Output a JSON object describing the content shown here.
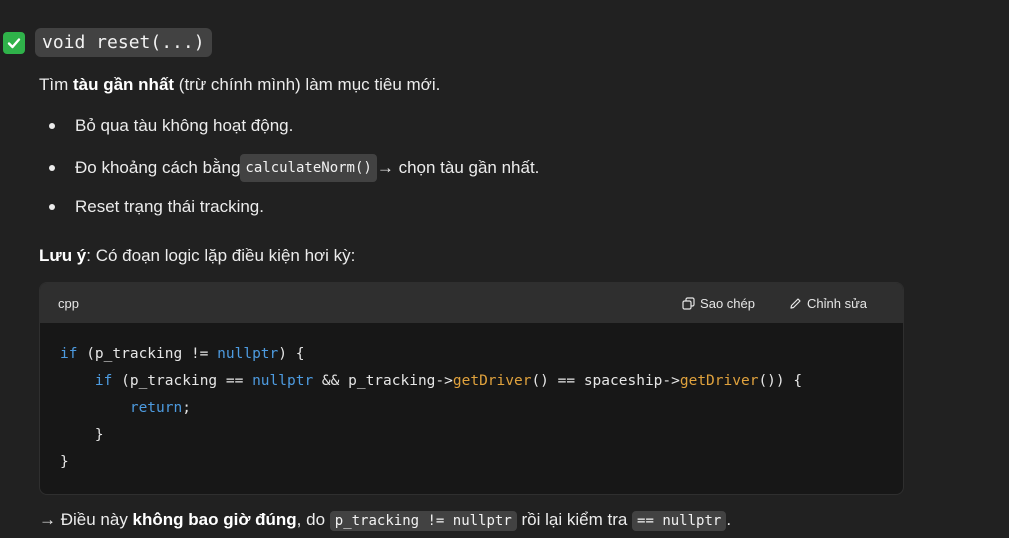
{
  "heading": {
    "code": "void reset(...)"
  },
  "intro": {
    "prefix": "Tìm ",
    "bold": "tàu gần nhất",
    "suffix": " (trừ chính mình) làm mục tiêu mới."
  },
  "bullets": {
    "item1": "Bỏ qua tàu không hoạt động.",
    "item2_prefix": "Đo khoảng cách bằng ",
    "item2_code": "calculateNorm()",
    "item2_suffix": " → chọn tàu gần nhất.",
    "item3": "Reset trạng thái tracking."
  },
  "note": {
    "bold": "Lưu ý",
    "text": ": Có đoạn logic lặp điều kiện hơi kỳ:"
  },
  "codeblock": {
    "language": "cpp",
    "copy_label": "Sao chép",
    "edit_label": "Chỉnh sửa",
    "line1_kw": "if",
    "line1_a": " (p_tracking != ",
    "line1_null": "nullptr",
    "line1_b": ") {",
    "line2_indent": "    ",
    "line2_kw": "if",
    "line2_a": " (p_tracking == ",
    "line2_null": "nullptr",
    "line2_b": " && p_tracking->",
    "line2_fn1": "getDriver",
    "line2_c": "() == spaceship->",
    "line2_fn2": "getDriver",
    "line2_d": "()) {",
    "line3_indent": "        ",
    "line3_kw": "return",
    "line3_a": ";",
    "line4": "    }",
    "line5": "}"
  },
  "conclusion": {
    "prefix": "→ Điều này ",
    "bold": "không bao giờ đúng",
    "mid1": ", do ",
    "code1": "p_tracking != nullptr",
    "mid2": " rồi lại kiểm tra ",
    "code2": "== nullptr",
    "suffix": "."
  },
  "icons": {
    "check": "check-box-icon",
    "copy": "copy-icon",
    "edit": "pencil-icon"
  },
  "colors": {
    "background": "#212121",
    "check": "#2fb24a",
    "keyword": "#4d9be0",
    "function": "#e0a23d"
  }
}
